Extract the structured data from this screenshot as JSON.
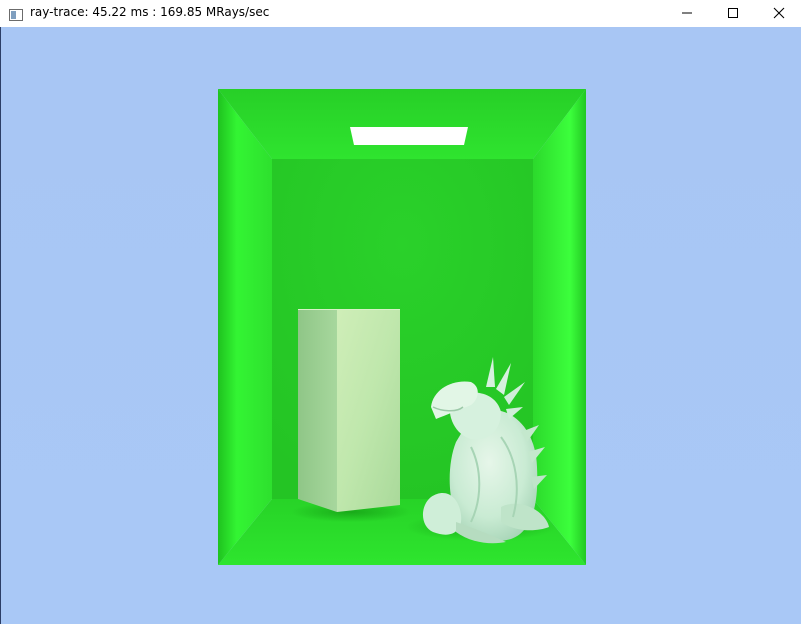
{
  "window": {
    "title": "ray-trace: 45.22 ms : 169.85 MRays/sec",
    "icon": "app-window-icon",
    "controls": {
      "minimize": "minimize-icon",
      "maximize": "maximize-icon",
      "close": "close-icon"
    }
  },
  "scene": {
    "description_icon": "rendered-viewport",
    "colors": {
      "background": "#a8c7f5",
      "wall_green": "#2bd42b",
      "wall_bright": "#3dff3d",
      "box_light": "#c5f2b5",
      "light": "#ffffff",
      "dragon": "#cfeed8"
    }
  }
}
